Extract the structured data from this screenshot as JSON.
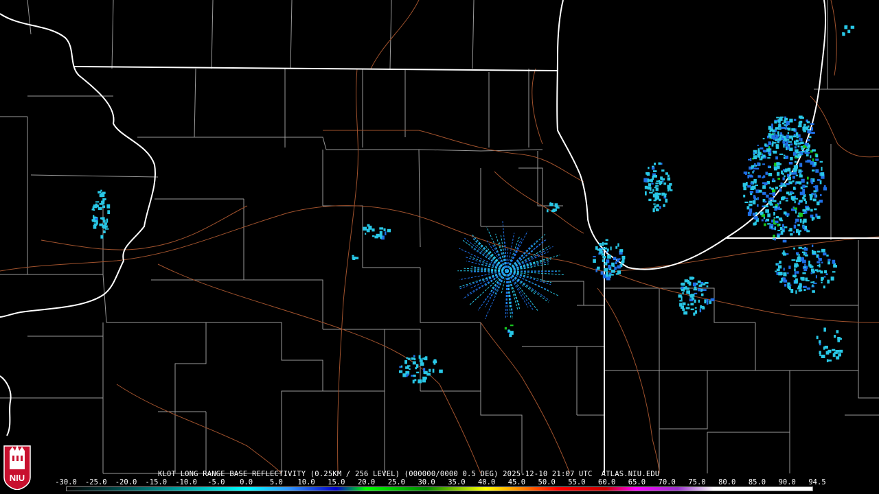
{
  "product_caption": "KLOT LONG RANGE BASE REFLECTIVITY (0.25KM / 256 LEVEL) (000000/0000 0.5 DEG) 2025-12-10 21:07 UTC  ATLAS.NIU.EDU",
  "logo_text": "NIU",
  "colorbar": {
    "ticks": [
      "-30.0",
      "-25.0",
      "-20.0",
      "-15.0",
      "-10.0",
      "-5.0",
      "0.0",
      "5.0",
      "10.0",
      "15.0",
      "20.0",
      "25.0",
      "30.0",
      "35.0",
      "40.0",
      "45.0",
      "50.0",
      "55.0",
      "60.0",
      "65.0",
      "70.0",
      "75.0",
      "80.0",
      "85.0",
      "90.0",
      "94.5"
    ],
    "min_dbz": -30.0,
    "max_dbz": 94.5,
    "stops": [
      {
        "dbz": -30,
        "color": "#000000"
      },
      {
        "dbz": 0,
        "color": "#00ffff"
      },
      {
        "dbz": 7,
        "color": "#3399ff"
      },
      {
        "dbz": 15,
        "color": "#0000cc"
      },
      {
        "dbz": 20,
        "color": "#00ff00"
      },
      {
        "dbz": 30,
        "color": "#008800"
      },
      {
        "dbz": 40,
        "color": "#ffff00"
      },
      {
        "dbz": 45,
        "color": "#ff9900"
      },
      {
        "dbz": 52,
        "color": "#ff0000"
      },
      {
        "dbz": 60,
        "color": "#cc0000"
      },
      {
        "dbz": 65,
        "color": "#ff00ff"
      },
      {
        "dbz": 72,
        "color": "#9933cc"
      },
      {
        "dbz": 78,
        "color": "#ffffff"
      },
      {
        "dbz": 94.5,
        "color": "#ffffff"
      }
    ]
  },
  "colors": {
    "background": "#000000",
    "county_lines": "#9a9a9a",
    "roads": "#a0522d",
    "state_lines": "#ffffff",
    "echo_light": "#29c7e6",
    "echo_mid": "#1f6fe6",
    "echo_strong": "#18c81e"
  }
}
